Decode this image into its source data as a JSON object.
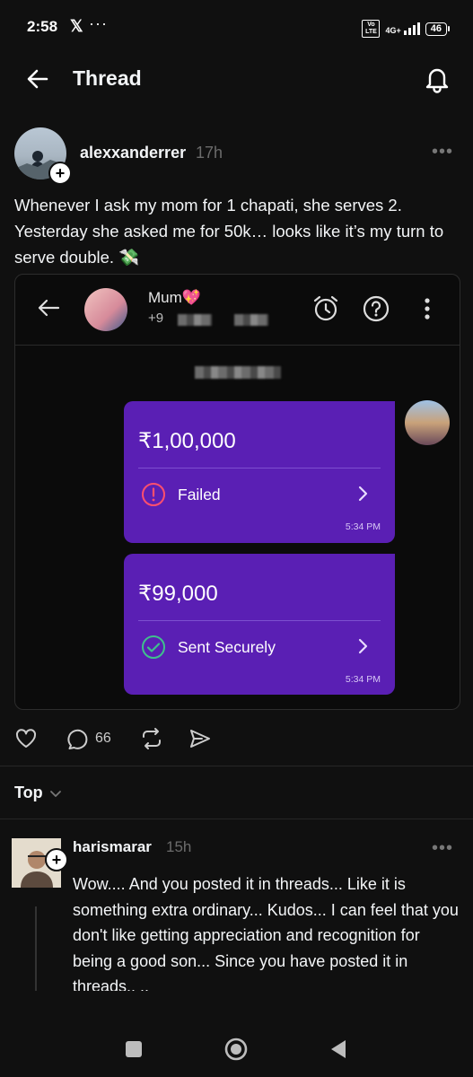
{
  "status_bar": {
    "time": "2:58",
    "x_logo": "𝕏",
    "dots": "···",
    "network": "4G+",
    "volte": "Vo LTE",
    "battery": "46"
  },
  "header": {
    "title": "Thread"
  },
  "post": {
    "username": "alexxanderrer",
    "time": "17h",
    "text": "Whenever I ask my mom for 1 chapati, she serves 2. Yesterday she asked me for 50k… looks like it’s my turn to serve double. 💸",
    "comments_count": "66"
  },
  "embedded": {
    "contact_name": "Mum💖",
    "phone_prefix": "+9",
    "transactions": [
      {
        "amount": "₹1,00,000",
        "status": "Failed",
        "time": "5:34 PM",
        "status_color": "#ff4f6e"
      },
      {
        "amount": "₹99,000",
        "status": "Sent Securely",
        "time": "5:34 PM",
        "status_color": "#3fc08d"
      }
    ]
  },
  "filter": {
    "label": "Top"
  },
  "reply": {
    "username": "harismarar",
    "time": "15h",
    "text": "Wow.... And you posted it in threads... Like it is something extra ordinary... Kudos... I can feel that you don't like getting appreciation and recognition for being a good son... Since you have posted it in threads.. .."
  },
  "icons": {
    "back": "arrow-left-icon",
    "bell": "bell-icon",
    "heart": "heart-icon",
    "comment": "comment-icon",
    "repost": "repost-icon",
    "share": "share-icon"
  }
}
